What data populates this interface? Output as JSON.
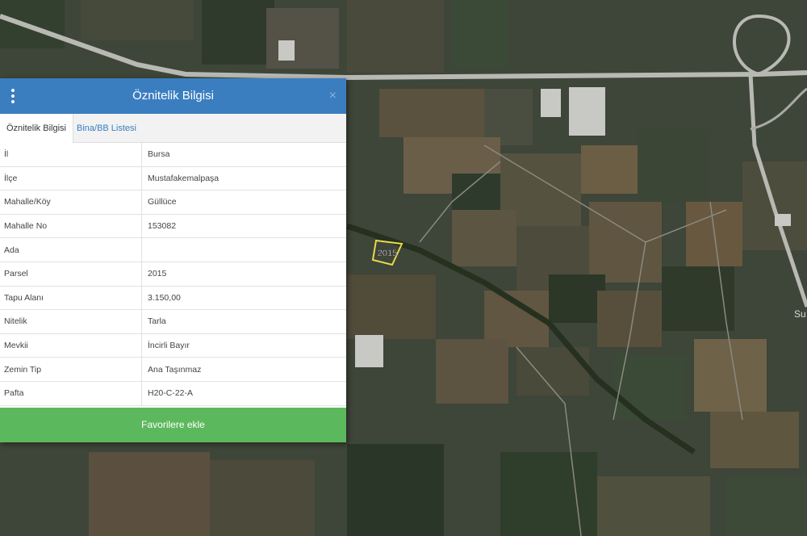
{
  "map": {
    "parcel_label": "2015",
    "place_label_partial": "Su",
    "colors": {
      "base": "#3d4438",
      "road": "#b9b9b4",
      "parcel": "#e8d94a"
    }
  },
  "panel": {
    "title": "Öznitelik Bilgisi",
    "menu_icon": "vertical-dots-icon",
    "close_label": "×",
    "tabs": [
      {
        "label": "Öznitelik Bilgisi",
        "active": true
      },
      {
        "label": "Bina/BB Listesi",
        "active": false
      }
    ],
    "rows": [
      {
        "key": "İl",
        "value": "Bursa"
      },
      {
        "key": "İlçe",
        "value": "Mustafakemalpaşa"
      },
      {
        "key": "Mahalle/Köy",
        "value": "Güllüce"
      },
      {
        "key": "Mahalle No",
        "value": "153082"
      },
      {
        "key": "Ada",
        "value": ""
      },
      {
        "key": "Parsel",
        "value": "2015"
      },
      {
        "key": "Tapu Alanı",
        "value": "3.150,00"
      },
      {
        "key": "Nitelik",
        "value": "Tarla"
      },
      {
        "key": "Mevkii",
        "value": "İncirli Bayır"
      },
      {
        "key": "Zemin Tip",
        "value": "Ana Taşınmaz"
      },
      {
        "key": "Pafta",
        "value": "H20-C-22-A"
      }
    ],
    "favorite_button": "Favorilere ekle",
    "colors": {
      "header": "#3a7ec0",
      "button": "#5cb85c"
    }
  }
}
